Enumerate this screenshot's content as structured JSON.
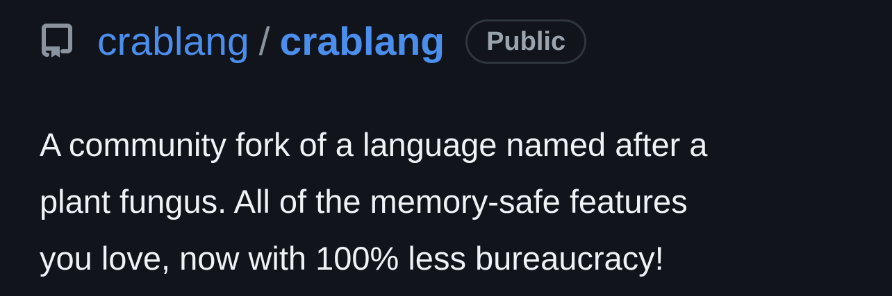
{
  "header": {
    "icon": "repo-icon",
    "owner": "crablang",
    "separator": "/",
    "repo_name": "crablang",
    "visibility_badge": "Public"
  },
  "description": "A community fork of a language named after a\nplant fungus. All of the memory-safe features\nyou love, now with 100% less bureaucracy!",
  "colors": {
    "background": "#11151b",
    "link": "#4b8eee",
    "muted": "#8b949e",
    "text": "#f0f3f6",
    "badge_border": "#30363d"
  }
}
